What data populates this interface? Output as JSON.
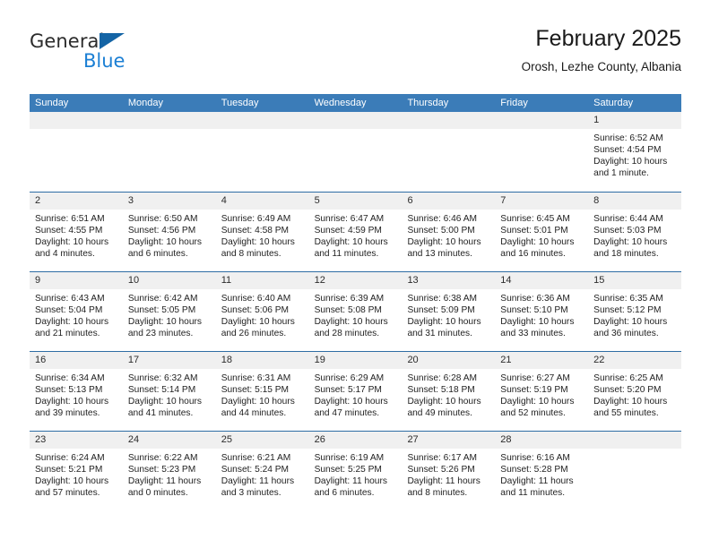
{
  "brand": {
    "name_top": "General",
    "name_bottom": "Blue",
    "accent_color": "#1b7fd4",
    "triangle_color": "#1464a5"
  },
  "header": {
    "title": "February 2025",
    "subtitle": "Orosh, Lezhe County, Albania"
  },
  "theme": {
    "header_row_bg": "#3b7cb8",
    "header_row_text": "#ffffff",
    "week_divider": "#2e6da4",
    "day_band_bg": "#f0f0f0"
  },
  "weekdays": [
    "Sunday",
    "Monday",
    "Tuesday",
    "Wednesday",
    "Thursday",
    "Friday",
    "Saturday"
  ],
  "weeks": [
    [
      {
        "day": "",
        "lines": []
      },
      {
        "day": "",
        "lines": []
      },
      {
        "day": "",
        "lines": []
      },
      {
        "day": "",
        "lines": []
      },
      {
        "day": "",
        "lines": []
      },
      {
        "day": "",
        "lines": []
      },
      {
        "day": "1",
        "lines": [
          "Sunrise: 6:52 AM",
          "Sunset: 4:54 PM",
          "Daylight: 10 hours",
          "and 1 minute."
        ]
      }
    ],
    [
      {
        "day": "2",
        "lines": [
          "Sunrise: 6:51 AM",
          "Sunset: 4:55 PM",
          "Daylight: 10 hours",
          "and 4 minutes."
        ]
      },
      {
        "day": "3",
        "lines": [
          "Sunrise: 6:50 AM",
          "Sunset: 4:56 PM",
          "Daylight: 10 hours",
          "and 6 minutes."
        ]
      },
      {
        "day": "4",
        "lines": [
          "Sunrise: 6:49 AM",
          "Sunset: 4:58 PM",
          "Daylight: 10 hours",
          "and 8 minutes."
        ]
      },
      {
        "day": "5",
        "lines": [
          "Sunrise: 6:47 AM",
          "Sunset: 4:59 PM",
          "Daylight: 10 hours",
          "and 11 minutes."
        ]
      },
      {
        "day": "6",
        "lines": [
          "Sunrise: 6:46 AM",
          "Sunset: 5:00 PM",
          "Daylight: 10 hours",
          "and 13 minutes."
        ]
      },
      {
        "day": "7",
        "lines": [
          "Sunrise: 6:45 AM",
          "Sunset: 5:01 PM",
          "Daylight: 10 hours",
          "and 16 minutes."
        ]
      },
      {
        "day": "8",
        "lines": [
          "Sunrise: 6:44 AM",
          "Sunset: 5:03 PM",
          "Daylight: 10 hours",
          "and 18 minutes."
        ]
      }
    ],
    [
      {
        "day": "9",
        "lines": [
          "Sunrise: 6:43 AM",
          "Sunset: 5:04 PM",
          "Daylight: 10 hours",
          "and 21 minutes."
        ]
      },
      {
        "day": "10",
        "lines": [
          "Sunrise: 6:42 AM",
          "Sunset: 5:05 PM",
          "Daylight: 10 hours",
          "and 23 minutes."
        ]
      },
      {
        "day": "11",
        "lines": [
          "Sunrise: 6:40 AM",
          "Sunset: 5:06 PM",
          "Daylight: 10 hours",
          "and 26 minutes."
        ]
      },
      {
        "day": "12",
        "lines": [
          "Sunrise: 6:39 AM",
          "Sunset: 5:08 PM",
          "Daylight: 10 hours",
          "and 28 minutes."
        ]
      },
      {
        "day": "13",
        "lines": [
          "Sunrise: 6:38 AM",
          "Sunset: 5:09 PM",
          "Daylight: 10 hours",
          "and 31 minutes."
        ]
      },
      {
        "day": "14",
        "lines": [
          "Sunrise: 6:36 AM",
          "Sunset: 5:10 PM",
          "Daylight: 10 hours",
          "and 33 minutes."
        ]
      },
      {
        "day": "15",
        "lines": [
          "Sunrise: 6:35 AM",
          "Sunset: 5:12 PM",
          "Daylight: 10 hours",
          "and 36 minutes."
        ]
      }
    ],
    [
      {
        "day": "16",
        "lines": [
          "Sunrise: 6:34 AM",
          "Sunset: 5:13 PM",
          "Daylight: 10 hours",
          "and 39 minutes."
        ]
      },
      {
        "day": "17",
        "lines": [
          "Sunrise: 6:32 AM",
          "Sunset: 5:14 PM",
          "Daylight: 10 hours",
          "and 41 minutes."
        ]
      },
      {
        "day": "18",
        "lines": [
          "Sunrise: 6:31 AM",
          "Sunset: 5:15 PM",
          "Daylight: 10 hours",
          "and 44 minutes."
        ]
      },
      {
        "day": "19",
        "lines": [
          "Sunrise: 6:29 AM",
          "Sunset: 5:17 PM",
          "Daylight: 10 hours",
          "and 47 minutes."
        ]
      },
      {
        "day": "20",
        "lines": [
          "Sunrise: 6:28 AM",
          "Sunset: 5:18 PM",
          "Daylight: 10 hours",
          "and 49 minutes."
        ]
      },
      {
        "day": "21",
        "lines": [
          "Sunrise: 6:27 AM",
          "Sunset: 5:19 PM",
          "Daylight: 10 hours",
          "and 52 minutes."
        ]
      },
      {
        "day": "22",
        "lines": [
          "Sunrise: 6:25 AM",
          "Sunset: 5:20 PM",
          "Daylight: 10 hours",
          "and 55 minutes."
        ]
      }
    ],
    [
      {
        "day": "23",
        "lines": [
          "Sunrise: 6:24 AM",
          "Sunset: 5:21 PM",
          "Daylight: 10 hours",
          "and 57 minutes."
        ]
      },
      {
        "day": "24",
        "lines": [
          "Sunrise: 6:22 AM",
          "Sunset: 5:23 PM",
          "Daylight: 11 hours",
          "and 0 minutes."
        ]
      },
      {
        "day": "25",
        "lines": [
          "Sunrise: 6:21 AM",
          "Sunset: 5:24 PM",
          "Daylight: 11 hours",
          "and 3 minutes."
        ]
      },
      {
        "day": "26",
        "lines": [
          "Sunrise: 6:19 AM",
          "Sunset: 5:25 PM",
          "Daylight: 11 hours",
          "and 6 minutes."
        ]
      },
      {
        "day": "27",
        "lines": [
          "Sunrise: 6:17 AM",
          "Sunset: 5:26 PM",
          "Daylight: 11 hours",
          "and 8 minutes."
        ]
      },
      {
        "day": "28",
        "lines": [
          "Sunrise: 6:16 AM",
          "Sunset: 5:28 PM",
          "Daylight: 11 hours",
          "and 11 minutes."
        ]
      },
      {
        "day": "",
        "lines": []
      }
    ]
  ]
}
